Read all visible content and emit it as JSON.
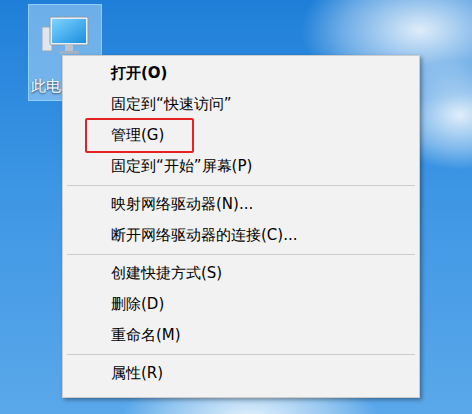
{
  "desktop": {
    "icons": [
      {
        "label": "此电",
        "selected": true
      }
    ]
  },
  "context_menu": {
    "items": [
      {
        "kind": "item",
        "label": "打开(O)",
        "default": true,
        "marked": false
      },
      {
        "kind": "item",
        "label": "固定到“快速访问”",
        "default": false,
        "marked": false
      },
      {
        "kind": "item",
        "label": "管理(G)",
        "default": false,
        "marked": true
      },
      {
        "kind": "item",
        "label": "固定到“开始”屏幕(P)",
        "default": false,
        "marked": false
      },
      {
        "kind": "separator"
      },
      {
        "kind": "item",
        "label": "映射网络驱动器(N)...",
        "default": false,
        "marked": false
      },
      {
        "kind": "item",
        "label": "断开网络驱动器的连接(C)...",
        "default": false,
        "marked": false
      },
      {
        "kind": "separator"
      },
      {
        "kind": "item",
        "label": "创建快捷方式(S)",
        "default": false,
        "marked": false
      },
      {
        "kind": "item",
        "label": "删除(D)",
        "default": false,
        "marked": false
      },
      {
        "kind": "item",
        "label": "重命名(M)",
        "default": false,
        "marked": false
      },
      {
        "kind": "separator"
      },
      {
        "kind": "item",
        "label": "属性(R)",
        "default": false,
        "marked": false
      }
    ]
  }
}
